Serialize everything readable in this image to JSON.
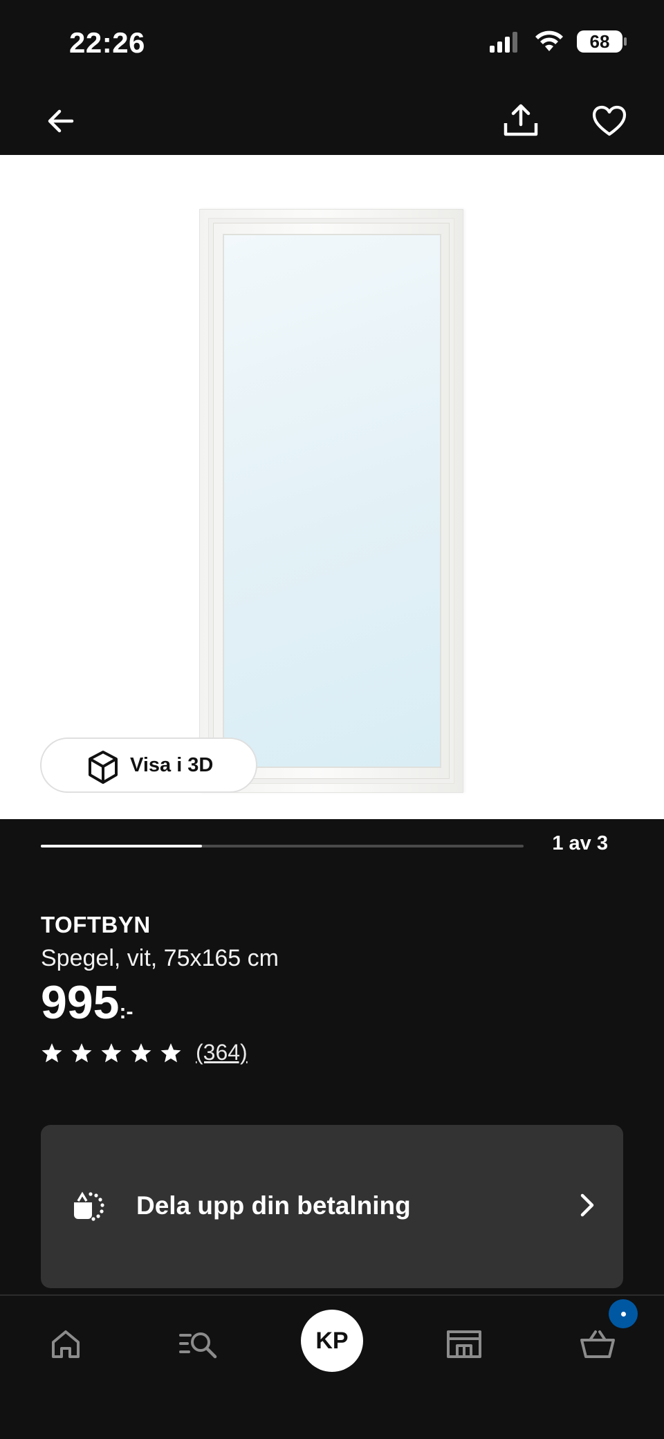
{
  "status_bar": {
    "time": "22:26",
    "battery_percent": "68",
    "icons": [
      "cellular-signal-icon",
      "wifi-icon",
      "battery-icon"
    ]
  },
  "nav": {
    "icons": [
      "back-arrow-icon",
      "share-icon",
      "heart-icon"
    ]
  },
  "gallery": {
    "view_3d_label": "Visa i 3D",
    "progress_fraction": 0.3333,
    "counter": "1 av 3"
  },
  "product": {
    "name": "TOFTBYN",
    "description": "Spegel, vit, 75x165 cm",
    "price": "995",
    "price_suffix": ":-",
    "rating_stars": 5,
    "review_count": "(364)"
  },
  "payment": {
    "label": "Dela upp din betalning",
    "icon": "payment-split-icon"
  },
  "bottom_nav": {
    "avatar_initials": "KP",
    "items": [
      "home-icon",
      "search-list-icon",
      "profile-avatar",
      "store-icon",
      "cart-icon"
    ],
    "badge_color": "#0058a3"
  },
  "colors": {
    "background": "#111111",
    "card": "#333333",
    "accent": "#0058a3"
  }
}
